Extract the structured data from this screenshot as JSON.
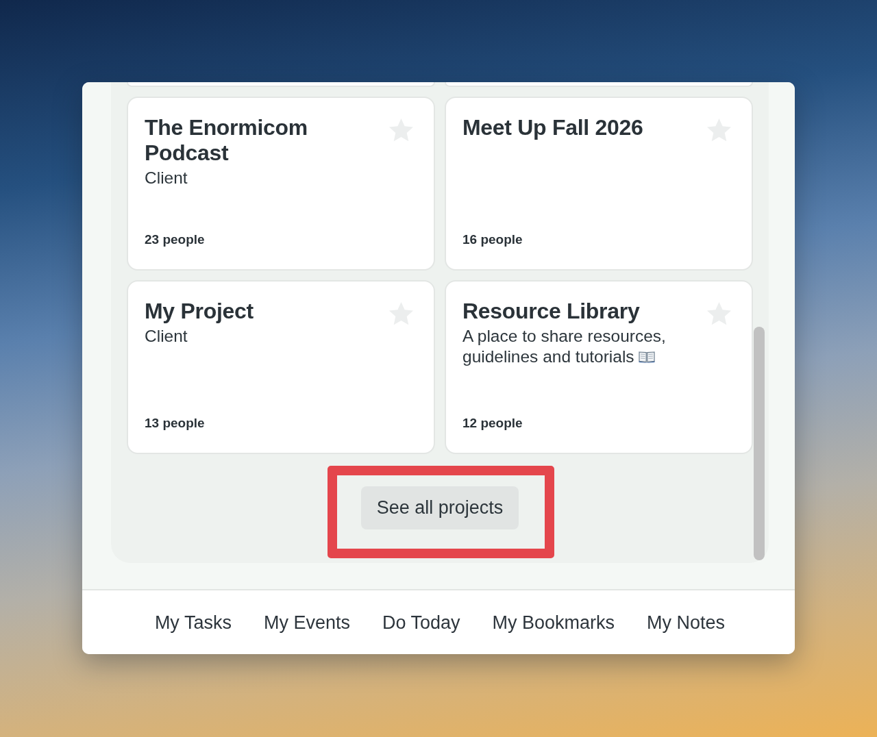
{
  "projects": [
    {
      "title": "The Enormicom Podcast",
      "description": "Client",
      "people": "23 people",
      "starred": false,
      "emoji": false
    },
    {
      "title": "Meet Up Fall 2026",
      "people": "16 people",
      "starred": false,
      "emoji": false
    },
    {
      "title": "My Project",
      "description": "Client",
      "people": "13 people",
      "starred": false,
      "emoji": false
    },
    {
      "title": "Resource Library",
      "description": "A place to share resources, guidelines and tutorials",
      "people": "12 people",
      "starred": false,
      "emoji": true
    }
  ],
  "see_all": {
    "label": "See all projects",
    "highlighted": true
  },
  "footer_links": [
    "My Tasks",
    "My Events",
    "Do Today",
    "My Bookmarks",
    "My Notes"
  ]
}
